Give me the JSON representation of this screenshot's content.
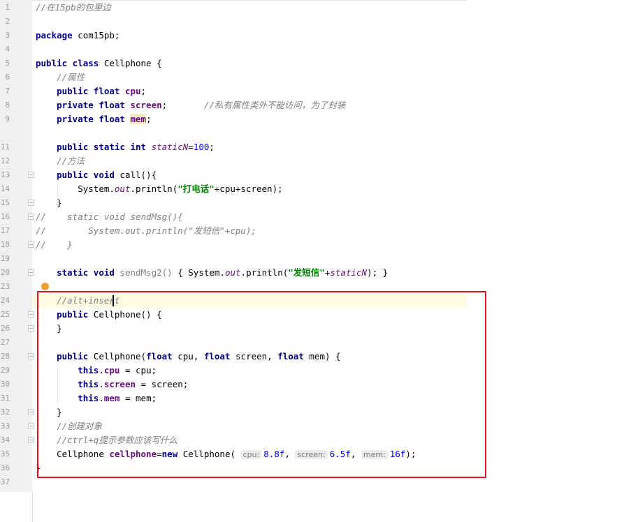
{
  "editor": {
    "line_numbers": [
      "1",
      "2",
      "3",
      "4",
      "5",
      "6",
      "7",
      "8",
      "9",
      "",
      "11",
      "12",
      "13",
      "14",
      "15",
      "16",
      "17",
      "18",
      "19",
      "20",
      "23",
      "24",
      "25",
      "26",
      "27",
      "28",
      "29",
      "30",
      "31",
      "32",
      "33",
      "34",
      "35",
      "36",
      "37"
    ],
    "comment_package": "//在15pb的包里边",
    "package_kw": "package",
    "package_name": " com15pb;",
    "class_mods": "public class",
    "class_name": " Cellphone {",
    "comment_attrs": "//属性",
    "cpu_mods": "public float",
    "cpu_name": "cpu",
    "screen_mods": "private float",
    "screen_name": "screen",
    "screen_comment": "//私有属性类外不能访问，为了封装",
    "mem_mods": "private float",
    "mem_name": "mem",
    "staticN_mods": "public static int",
    "staticN_name": "staticN",
    "staticN_value": "100",
    "comment_methods": "//方法",
    "call_mods": "public void",
    "call_sig": " call(){",
    "println_prefix": "System.",
    "out_field": "out",
    "println_call": ".println(",
    "call_string": "\"打电话\"",
    "call_args": "+cpu+screen);",
    "close_brace": "}",
    "cmt_sendmsg_1": "//    static void sendMsg(){",
    "cmt_sendmsg_2": "//        System.out.println(\"发短信\"+cpu);",
    "cmt_sendmsg_3": "//    }",
    "sendmsg2_mods": "static void",
    "sendmsg2_name": " sendMsg2()",
    "sendmsg2_body_open": " { System.",
    "sendmsg2_string": "\"发短信\"",
    "sendmsg2_tail": "); }",
    "comment_alt_insert": "//alt+insert",
    "ctor1_mods": "public",
    "ctor1_sig": " Cellphone() {",
    "ctor2_mods": "public",
    "ctor2_sig_a": " Cellphone(",
    "float_kw": "float",
    "ctor2_p1": " cpu, ",
    "ctor2_p2": " screen, ",
    "ctor2_p3": " mem) {",
    "this_kw": "this",
    "assign_cpu": " = cpu;",
    "assign_screen": " = screen;",
    "assign_mem": " = mem;",
    "comment_create": "//创建对象",
    "comment_ctrlq": "//ctrl+q提示参数应该写什么",
    "new_type": "Cellphone ",
    "new_var": "cellphone",
    "new_eq": "=",
    "new_kw": "new",
    "new_ctor": " Cellphone(",
    "hint_cpu": "cpu:",
    "val_cpu": "8.8f",
    "hint_screen": "screen:",
    "val_screen": "6.5f",
    "hint_mem": "mem:",
    "val_mem": "16f",
    "final_brace": "}"
  },
  "colors": {
    "highlight_box": "#e8101f",
    "keyword": "#000080",
    "string": "#008000",
    "field": "#660e7a",
    "comment": "#808080"
  }
}
